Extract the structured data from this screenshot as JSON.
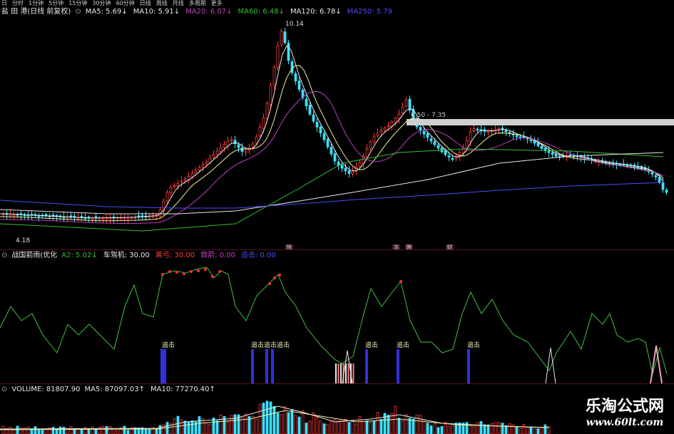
{
  "period_tabs": [
    "日",
    "分时",
    "1分钟",
    "5分钟",
    "15分钟",
    "30分钟",
    "60分钟",
    "日线",
    "周线",
    "月线",
    "多周期",
    "更多"
  ],
  "main_header": {
    "title": "盐 田 港(日线 前复权)",
    "items": [
      {
        "text": "MA5: 5.69↓",
        "color": "#e8e8e8"
      },
      {
        "text": "MA10: 5.91↓",
        "color": "#e8e8e8"
      },
      {
        "text": "MA20: 6.07↓",
        "color": "#c040c0"
      },
      {
        "text": "MA60: 6.48↓",
        "color": "#30c030"
      },
      {
        "text": "MA120: 6.78↓",
        "color": "#e8e8e8"
      },
      {
        "text": "MA250: 5.79",
        "color": "#4a4aff"
      }
    ]
  },
  "price_annotations": {
    "high": "10.14",
    "low": "4.18",
    "range": "6.50 - 7.35"
  },
  "event_markers": [
    "除",
    "冻",
    "腾",
    "财"
  ],
  "indicator_header": {
    "title": "战国箭雨(优化",
    "items": [
      {
        "text": "A2: 5.02↓",
        "color": "#30c030"
      },
      {
        "text": "车驾机: 30.00",
        "color": "#e8e8e8"
      },
      {
        "text": "离弓: 30.00",
        "color": "#ff4040"
      },
      {
        "text": "致箭: 0.00",
        "color": "#c040c0"
      },
      {
        "text": "追击: 0.00",
        "color": "#4a4aff"
      }
    ]
  },
  "signal_labels": [
    "追击",
    "追击",
    "追击",
    "追击",
    "追击",
    "追击",
    "追击"
  ],
  "volume_header": {
    "title": "VOLUME: 81807.90",
    "items": [
      {
        "text": "MA5: 87097.03↑",
        "color": "#e8e8e8"
      },
      {
        "text": "MA10: 77270.40↑",
        "color": "#e8e8e8"
      }
    ]
  },
  "watermark": {
    "name": "乐淘公式网",
    "url": "www.60lt.com"
  }
}
